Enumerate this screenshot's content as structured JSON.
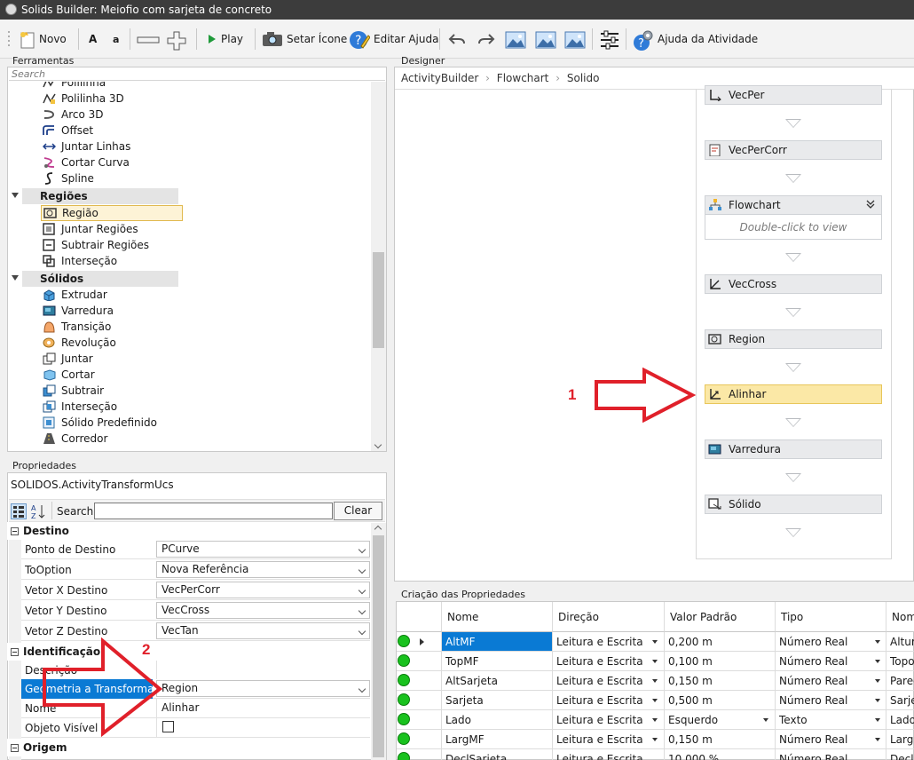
{
  "window": {
    "title": "Solids Builder: Meiofio com sarjeta de concreto"
  },
  "toolbar": {
    "novo": "Novo",
    "font_a_upper": "A",
    "font_a_lower": "a",
    "play": "Play",
    "setar_icone": "Setar Ícone",
    "editar_ajuda": "Editar Ajuda",
    "ajuda_atividade": "Ajuda da Atividade"
  },
  "ferramentas": {
    "label": "Ferramentas",
    "search_placeholder": "Search",
    "items_top": [
      "Polilinha",
      "Polilinha 3D",
      "Arco 3D",
      "Offset",
      "Juntar Linhas",
      "Cortar Curva",
      "Spline"
    ],
    "cat_regioes": "Regiões",
    "regioes": [
      "Região",
      "Juntar Regiões",
      "Subtrair Regiões",
      "Interseção"
    ],
    "cat_solidos": "Sólidos",
    "solidos": [
      "Extrudar",
      "Varredura",
      "Transição",
      "Revolução",
      "Juntar",
      "Cortar",
      "Subtrair",
      "Interseção",
      "Sólido Predefinido",
      "Corredor"
    ]
  },
  "propriedades": {
    "label": "Propriedades",
    "class_name": "SOLIDOS.ActivityTransformUcs",
    "search_label": "Search:",
    "clear": "Clear",
    "cat_destino": "Destino",
    "destino": [
      {
        "name": "Ponto de Destino",
        "value": "PCurve"
      },
      {
        "name": "ToOption",
        "value": "Nova Referência"
      },
      {
        "name": "Vetor X Destino",
        "value": "VecPerCorr"
      },
      {
        "name": "Vetor Y Destino",
        "value": "VecCross"
      },
      {
        "name": "Vetor Z Destino",
        "value": "VecTan"
      }
    ],
    "cat_identificacao": "Identificação",
    "descricao": "Descrição",
    "geometria": {
      "name": "Geometria a Transformar",
      "value": "Region"
    },
    "nome": {
      "name": "Nome",
      "value": "Alinhar"
    },
    "objeto_visivel": "Objeto Visível",
    "cat_origem": "Origem"
  },
  "designer": {
    "label": "Designer",
    "breadcrumb": [
      "ActivityBuilder",
      "Flowchart",
      "Solido"
    ],
    "activities": [
      "VecPer",
      "VecPerCorr",
      "Flowchart",
      "VecCross",
      "Region",
      "Alinhar",
      "Varredura",
      "Sólido"
    ],
    "flowchart_hint": "Double-click to view"
  },
  "criacao": {
    "label": "Criação das Propriedades",
    "headers": [
      "Nome",
      "Direção",
      "Valor Padrão",
      "Tipo",
      "Nome"
    ],
    "rows": [
      [
        "AltMF",
        "Leitura e Escrita",
        "0,200 m",
        "Número Real",
        "Altura"
      ],
      [
        "TopMF",
        "Leitura e Escrita",
        "0,100 m",
        "Número Real",
        "Topo"
      ],
      [
        "AltSarjeta",
        "Leitura e Escrita",
        "0,150 m",
        "Número Real",
        "Pared"
      ],
      [
        "Sarjeta",
        "Leitura e Escrita",
        "0,500 m",
        "Número Real",
        "Sarjet"
      ],
      [
        "Lado",
        "Leitura e Escrita",
        "Esquerdo",
        "Texto",
        "Lado"
      ],
      [
        "LargMF",
        "Leitura e Escrita",
        "0,150 m",
        "Número Real",
        "Largur"
      ],
      [
        "DeclSarjeta",
        "Leitura e Escrita",
        "10,000 %",
        "Número Real",
        "Decli"
      ]
    ]
  },
  "annotations": {
    "one": "1",
    "two": "2"
  },
  "colors": {
    "selected_row": "#0a7ad4",
    "highlight_activity": "#fbe8a6",
    "arrow_red": "#e0202a",
    "status_green": "#19c21e"
  }
}
